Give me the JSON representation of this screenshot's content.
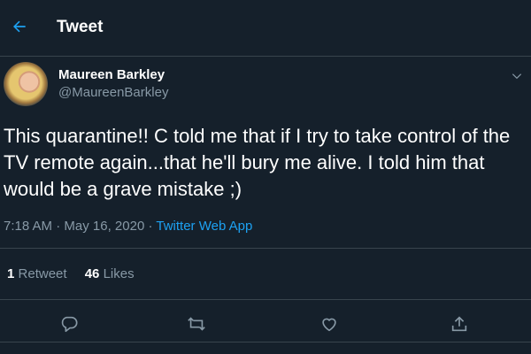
{
  "header": {
    "title": "Tweet",
    "back_icon": "back-arrow-icon"
  },
  "author": {
    "name": "Maureen Barkley",
    "handle": "@MaureenBarkley"
  },
  "tweet": {
    "text": "This quarantine!! C told me that if I try to take control of the TV remote again...that he'll bury me alive. I told him that would be a grave mistake ;)",
    "time": "7:18 AM",
    "date": "May 16, 2020",
    "separator": "·",
    "source": "Twitter Web App"
  },
  "stats": {
    "retweets": {
      "count": "1",
      "label": "Retweet"
    },
    "likes": {
      "count": "46",
      "label": "Likes"
    }
  },
  "actions": {
    "icons": [
      "reply-icon",
      "retweet-icon",
      "like-icon",
      "share-icon"
    ]
  },
  "colors": {
    "background": "#15202b",
    "accent": "#1da1f2",
    "secondary_text": "#8899a6",
    "divider": "#38444d"
  }
}
